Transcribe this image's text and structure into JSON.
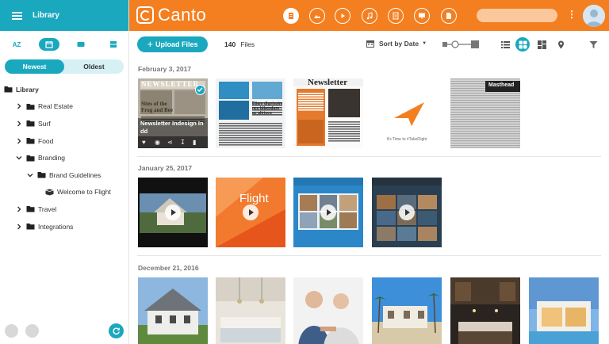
{
  "sidebar": {
    "title": "Library",
    "view_modes": [
      "AZ",
      "date",
      "grid",
      "list"
    ],
    "sort_tabs": [
      {
        "label": "Newest",
        "active": true
      },
      {
        "label": "Oldest",
        "active": false
      }
    ],
    "tree": [
      {
        "label": "Library",
        "level": 0,
        "expanded": true
      },
      {
        "label": "Real Estate",
        "level": 1,
        "expanded": false
      },
      {
        "label": "Surf",
        "level": 1,
        "expanded": false
      },
      {
        "label": "Food",
        "level": 1,
        "expanded": false
      },
      {
        "label": "Branding",
        "level": 1,
        "expanded": true
      },
      {
        "label": "Brand Guidelines",
        "level": 2,
        "expanded": true
      },
      {
        "label": "Welcome to Flight",
        "level": 3,
        "expanded": false
      },
      {
        "label": "Travel",
        "level": 1,
        "expanded": false
      },
      {
        "label": "Integrations",
        "level": 1,
        "expanded": false
      }
    ]
  },
  "topbar": {
    "app_name": "Canto",
    "brand_color": "#f47f20",
    "accent_color": "#1aa8bf",
    "type_filters": [
      "all-files-icon",
      "image-icon",
      "video-icon",
      "audio-icon",
      "document-icon",
      "presentation-icon",
      "other-file-icon"
    ],
    "search_placeholder": "",
    "more_glyph": "⋮"
  },
  "toolbar": {
    "upload_label": "Upload Files",
    "file_count": "140",
    "file_count_label": "Files",
    "sort_label": "Sort by Date",
    "views": [
      "list-view-icon",
      "grid-view-icon",
      "large-grid-icon",
      "map-view-icon",
      "filter-icon"
    ]
  },
  "groups": [
    {
      "date": "February 3, 2017",
      "items": [
        {
          "kind": "newsletter-selected",
          "title": "Newsletter Indesign In",
          "sub": "dd",
          "header": "NEWSLETTER",
          "caption": "Sites of the Frog and Bee"
        },
        {
          "kind": "newsletter-blue",
          "caption": "Etiam dignissim nec bibendum ac ultrices"
        },
        {
          "kind": "newsletter-orange",
          "header": "Newsletter"
        },
        {
          "kind": "flight-logo",
          "caption": "It's Time to #TakeFlight"
        },
        {
          "kind": "masthead",
          "header": "Masthead"
        }
      ]
    },
    {
      "date": "January 25, 2017",
      "items": [
        {
          "kind": "video-house"
        },
        {
          "kind": "video-flight",
          "header": "Flight"
        },
        {
          "kind": "video-site-blue"
        },
        {
          "kind": "video-site-dark"
        }
      ]
    },
    {
      "date": "December 21, 2016",
      "items": [
        {
          "kind": "photo-house-white"
        },
        {
          "kind": "photo-kitchen"
        },
        {
          "kind": "photo-couple"
        },
        {
          "kind": "photo-villa"
        },
        {
          "kind": "photo-kitchen-dark"
        },
        {
          "kind": "photo-modern-house"
        }
      ]
    }
  ]
}
